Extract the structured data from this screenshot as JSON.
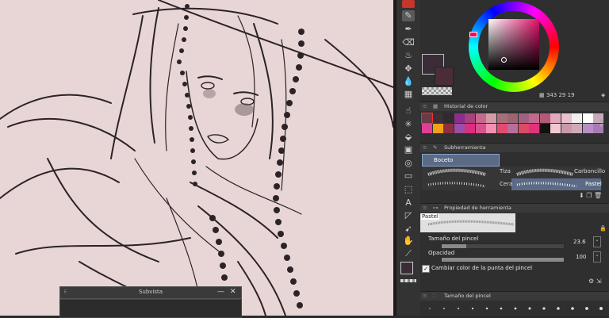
{
  "subview": {
    "title": "Subvista",
    "minimize": "—",
    "close": "✕"
  },
  "toolbar": {
    "tools": [
      "eyedropper-icon",
      "pen-nib-icon",
      "eraser-icon",
      "fill-tool-icon",
      "move-icon",
      "blend-icon",
      "grid-icon",
      "object-selector-icon",
      "magic-wand-icon",
      "bucket-icon",
      "gradient-icon",
      "lasso-icon",
      "rectangle-select-icon",
      "figure-icon",
      "text-icon",
      "ruler-icon",
      "operation-icon",
      "hand-icon",
      "color-picker-icon"
    ]
  },
  "color_wheel": {
    "h": "343",
    "s": "29",
    "v": "19"
  },
  "colors": {
    "main": "#3a2d37",
    "sub": "#4a2d36",
    "picker_hue": "#e0106a"
  },
  "panels": {
    "color_history": {
      "title": "Historial de color"
    },
    "subtool": {
      "title": "Subherramienta",
      "group": "Boceto",
      "brushes": [
        "Tiza",
        "Carboncillo",
        "Cera",
        "Pastel"
      ]
    },
    "tool_property": {
      "title": "Propiedad de herramienta",
      "brush_name": "Pastel",
      "brush_size_label": "Tamaño del pincel",
      "brush_size_value": "23.6",
      "opacity_label": "Opacidad",
      "opacity_value": "100",
      "color_jitter_label": "Cambiar color de la punta del pincel"
    },
    "brush_size": {
      "title": "Tamaño del pincel"
    }
  },
  "swatches": [
    "#6b3a45",
    "#3c2f37",
    "#2d2a30",
    "#8b2f8a",
    "#a8427c",
    "#c46a8e",
    "#d49aa8",
    "#a76f7a",
    "#9c6570",
    "#a0627f",
    "#c06a8f",
    "#b35a76",
    "#e3a8bd",
    "#e9c0d0",
    "#f0f0f0",
    "#ffffff",
    "#c9a9b8",
    "#e13f94",
    "#f2a015",
    "#8e2f3f",
    "#9a4fa7",
    "#d92f7d",
    "#d6548d",
    "#f28fb3",
    "#e04b6e",
    "#b86f9d",
    "#dc4a66",
    "#e0337c",
    "#111111",
    "#f0c8d0",
    "#c89aa7",
    "#d2a9b7",
    "#b790c7",
    "#a77bb3"
  ]
}
